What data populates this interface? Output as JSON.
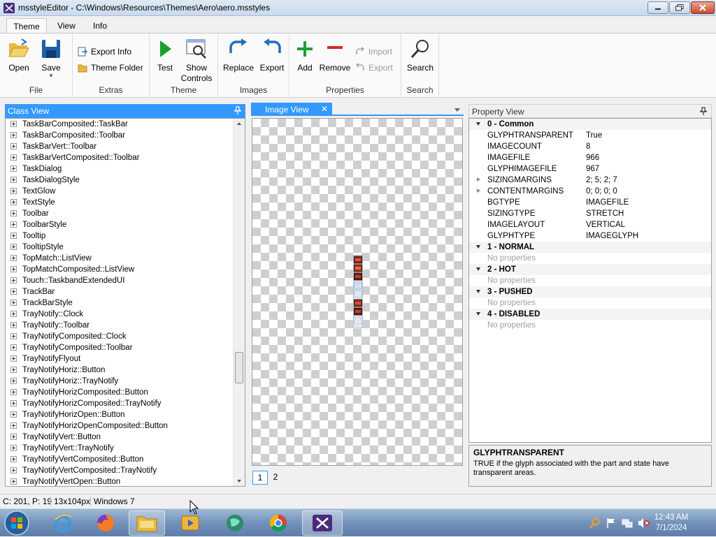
{
  "window": {
    "title": "msstyleEditor - C:\\Windows\\Resources\\Themes\\Aero\\aero.msstyles"
  },
  "ribbon": {
    "tabs": [
      "Theme",
      "View",
      "Info"
    ],
    "groups": {
      "file": {
        "label": "File",
        "open": "Open",
        "save": "Save"
      },
      "extras": {
        "label": "Extras",
        "export_info": "Export Info",
        "theme_folder": "Theme Folder"
      },
      "theme": {
        "label": "Theme",
        "test": "Test",
        "show_controls_1": "Show",
        "show_controls_2": "Controls"
      },
      "images": {
        "label": "Images",
        "replace": "Replace",
        "export": "Export"
      },
      "properties": {
        "label": "Properties",
        "add": "Add",
        "remove": "Remove",
        "import": "Import",
        "export": "Export"
      },
      "search": {
        "label": "Search",
        "search": "Search"
      }
    }
  },
  "class_view": {
    "title": "Class View",
    "items": [
      "TaskBarComposited::TaskBar",
      "TaskBarComposited::Toolbar",
      "TaskBarVert::Toolbar",
      "TaskBarVertComposited::Toolbar",
      "TaskDialog",
      "TaskDialogStyle",
      "TextGlow",
      "TextStyle",
      "Toolbar",
      "ToolbarStyle",
      "Tooltip",
      "TooltipStyle",
      "TopMatch::ListView",
      "TopMatchComposited::ListView",
      "Touch::TaskbandExtendedUI",
      "TrackBar",
      "TrackBarStyle",
      "TrayNotify::Clock",
      "TrayNotify::Toolbar",
      "TrayNotifyComposited::Clock",
      "TrayNotifyComposited::Toolbar",
      "TrayNotifyFlyout",
      "TrayNotifyHoriz::Button",
      "TrayNotifyHoriz::TrayNotify",
      "TrayNotifyHorizComposited::Button",
      "TrayNotifyHorizComposited::TrayNotify",
      "TrayNotifyHorizOpen::Button",
      "TrayNotifyHorizOpenComposited::Button",
      "TrayNotifyVert::Button",
      "TrayNotifyVert::TrayNotify",
      "TrayNotifyVertComposited::Button",
      "TrayNotifyVertComposited::TrayNotify",
      "TrayNotifyVertOpen::Button"
    ]
  },
  "image_view": {
    "tab_label": "Image View",
    "close": "✕",
    "pages": [
      "1",
      "2"
    ]
  },
  "property_view": {
    "title": "Property View",
    "categories": [
      {
        "name": "0 - Common",
        "props": [
          {
            "key": "GLYPHTRANSPARENT",
            "value": "True"
          },
          {
            "key": "IMAGECOUNT",
            "value": "8"
          },
          {
            "key": "IMAGEFILE",
            "value": "966"
          },
          {
            "key": "GLYPHIMAGEFILE",
            "value": "967"
          },
          {
            "key": "SIZINGMARGINS",
            "value": "2; 5; 2; 7",
            "expandable": true
          },
          {
            "key": "CONTENTMARGINS",
            "value": "0; 0; 0; 0",
            "expandable": true
          },
          {
            "key": "BGTYPE",
            "value": "IMAGEFILE"
          },
          {
            "key": "SIZINGTYPE",
            "value": "STRETCH"
          },
          {
            "key": "IMAGELAYOUT",
            "value": "VERTICAL"
          },
          {
            "key": "GLYPHTYPE",
            "value": "IMAGEGLYPH"
          }
        ]
      },
      {
        "name": "1 - NORMAL",
        "empty": "No properties"
      },
      {
        "name": "2 - HOT",
        "empty": "No properties"
      },
      {
        "name": "3 - PUSHED",
        "empty": "No properties"
      },
      {
        "name": "4 - DISABLED",
        "empty": "No properties"
      }
    ],
    "description": {
      "title": "GLYPHTRANSPARENT",
      "text": "TRUE if the glyph associated with the part and state have transparent areas."
    }
  },
  "status_bar": {
    "position": "C: 201, P: 19",
    "size": "13x104px",
    "platform": "Windows 7"
  },
  "taskbar": {
    "time": "12:43 AM",
    "date": "7/1/2024"
  },
  "colors": {
    "accent": "#3399ff",
    "add_green": "#1e9e2e",
    "remove_red": "#d42a20",
    "icon_blue": "#1f6fbf"
  }
}
